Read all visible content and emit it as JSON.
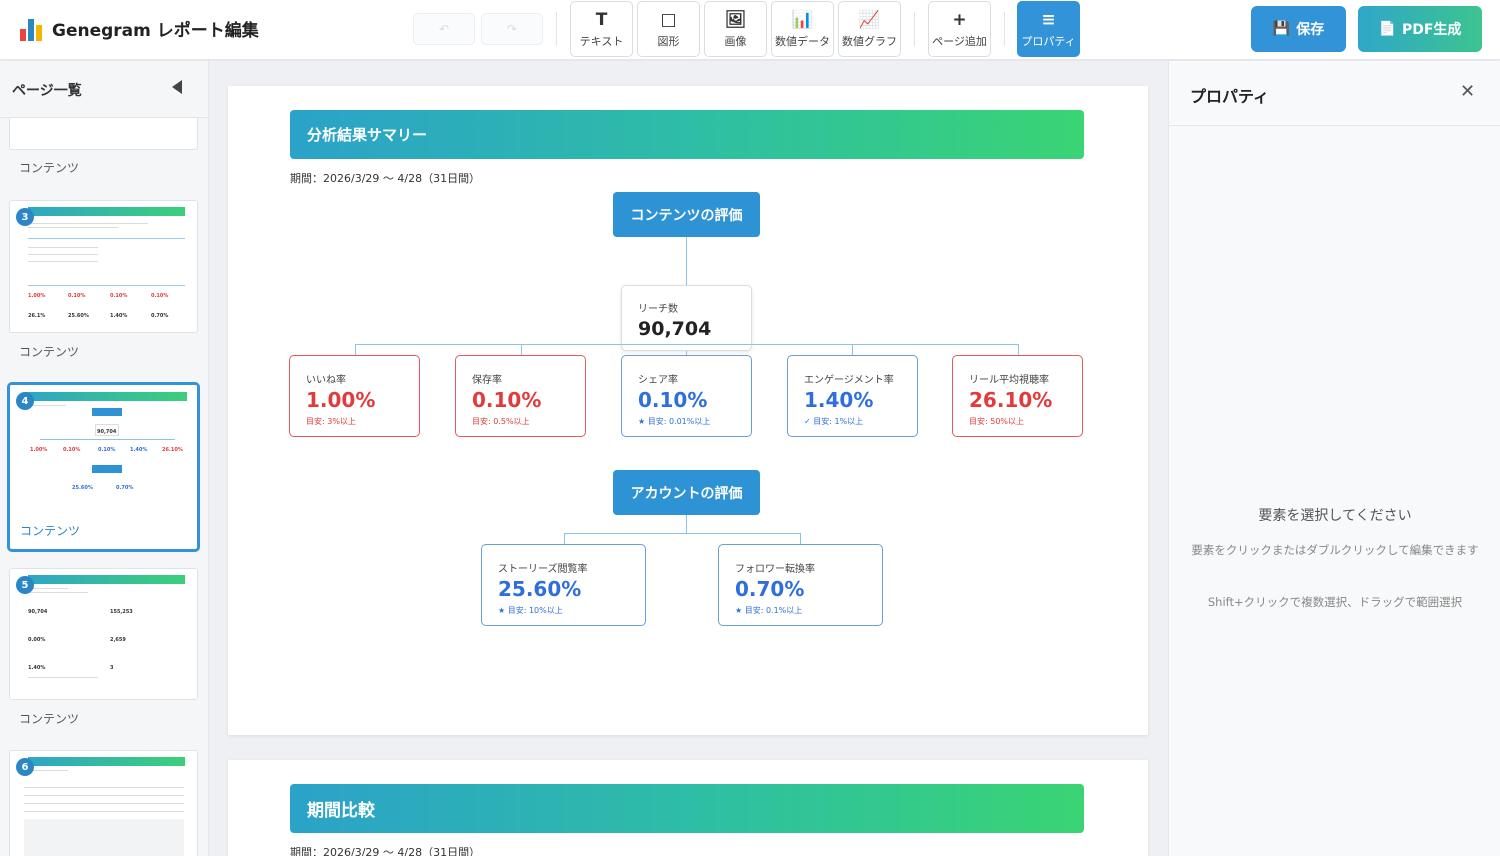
{
  "header": {
    "title": "Genegram レポート編集",
    "undo_icon": "↶",
    "redo_icon": "↷",
    "tools": [
      {
        "name": "text",
        "icon": "T",
        "label": "テキスト"
      },
      {
        "name": "shape",
        "icon": "□",
        "label": "図形"
      },
      {
        "name": "image",
        "icon": "🖼",
        "label": "画像"
      },
      {
        "name": "numeric-data",
        "icon": "📊",
        "label": "数値データ"
      },
      {
        "name": "numeric-graph",
        "icon": "📈",
        "label": "数値グラフ"
      },
      {
        "name": "add-page",
        "icon": "+",
        "label": "ページ追加"
      },
      {
        "name": "properties",
        "icon": "≡",
        "label": "プロパティ"
      }
    ],
    "save_icon": "💾",
    "save_label": "保存",
    "pdf_icon": "📄",
    "pdf_label": "PDF生成",
    "logo_colors": [
      "#e8453c",
      "#2b86c5",
      "#f4b400"
    ]
  },
  "sidebar": {
    "title": "ページ一覧",
    "pages": [
      {
        "number": "",
        "label": "コンテンツ"
      },
      {
        "number": "3",
        "label": "コンテンツ"
      },
      {
        "number": "4",
        "label": "コンテンツ",
        "selected": true
      },
      {
        "number": "5",
        "label": "コンテンツ"
      },
      {
        "number": "6",
        "label": ""
      }
    ],
    "thumb_values": {
      "p3": [
        "1.00%",
        "0.10%",
        "0.10%",
        "0.10%",
        "26.1%",
        "25.60%",
        "1.40%",
        "0.70%"
      ],
      "p4": [
        "90,704",
        "1.00%",
        "0.10%",
        "0.10%",
        "1.40%",
        "26.10%",
        "25.60%",
        "0.70%"
      ],
      "p5": [
        "90,704",
        "155,253",
        "0.00%",
        "2,659",
        "1.40%",
        "3"
      ]
    }
  },
  "canvas": {
    "page1": {
      "banner": "分析結果サマリー",
      "period": "期間：2026/3/29 〜 4/28（31日間）",
      "content_eval": "コンテンツの評価",
      "reach": {
        "label": "リーチ数",
        "value": "90,704"
      },
      "metrics": [
        {
          "label": "いいね率",
          "value": "1.00%",
          "note": "目安: 3%以上",
          "status": "red"
        },
        {
          "label": "保存率",
          "value": "0.10%",
          "note": "目安: 0.5%以上",
          "status": "red"
        },
        {
          "label": "シェア率",
          "value": "0.10%",
          "note": "★ 目安: 0.01%以上",
          "status": "blue"
        },
        {
          "label": "エンゲージメント率",
          "value": "1.40%",
          "note": "✓ 目安: 1%以上",
          "status": "blue"
        },
        {
          "label": "リール平均視聴率",
          "value": "26.10%",
          "note": "目安: 50%以上",
          "status": "red"
        }
      ],
      "account_eval": "アカウントの評価",
      "account_metrics": [
        {
          "label": "ストーリーズ閲覧率",
          "value": "25.60%",
          "note": "★ 目安: 10%以上",
          "status": "blue"
        },
        {
          "label": "フォロワー転換率",
          "value": "0.70%",
          "note": "★ 目安: 0.1%以上",
          "status": "blue"
        }
      ]
    },
    "page2": {
      "banner": "期間比較",
      "period": "期間：2026/3/29 〜 4/28（31日間）"
    }
  },
  "properties": {
    "title": "プロパティ",
    "close_icon": "✕",
    "empty_title": "要素を選択してください",
    "empty_help": "要素をクリックまたはダブルクリックして編集できます",
    "empty_help2": "Shift+クリックで複数選択、ドラッグで範囲選択"
  }
}
